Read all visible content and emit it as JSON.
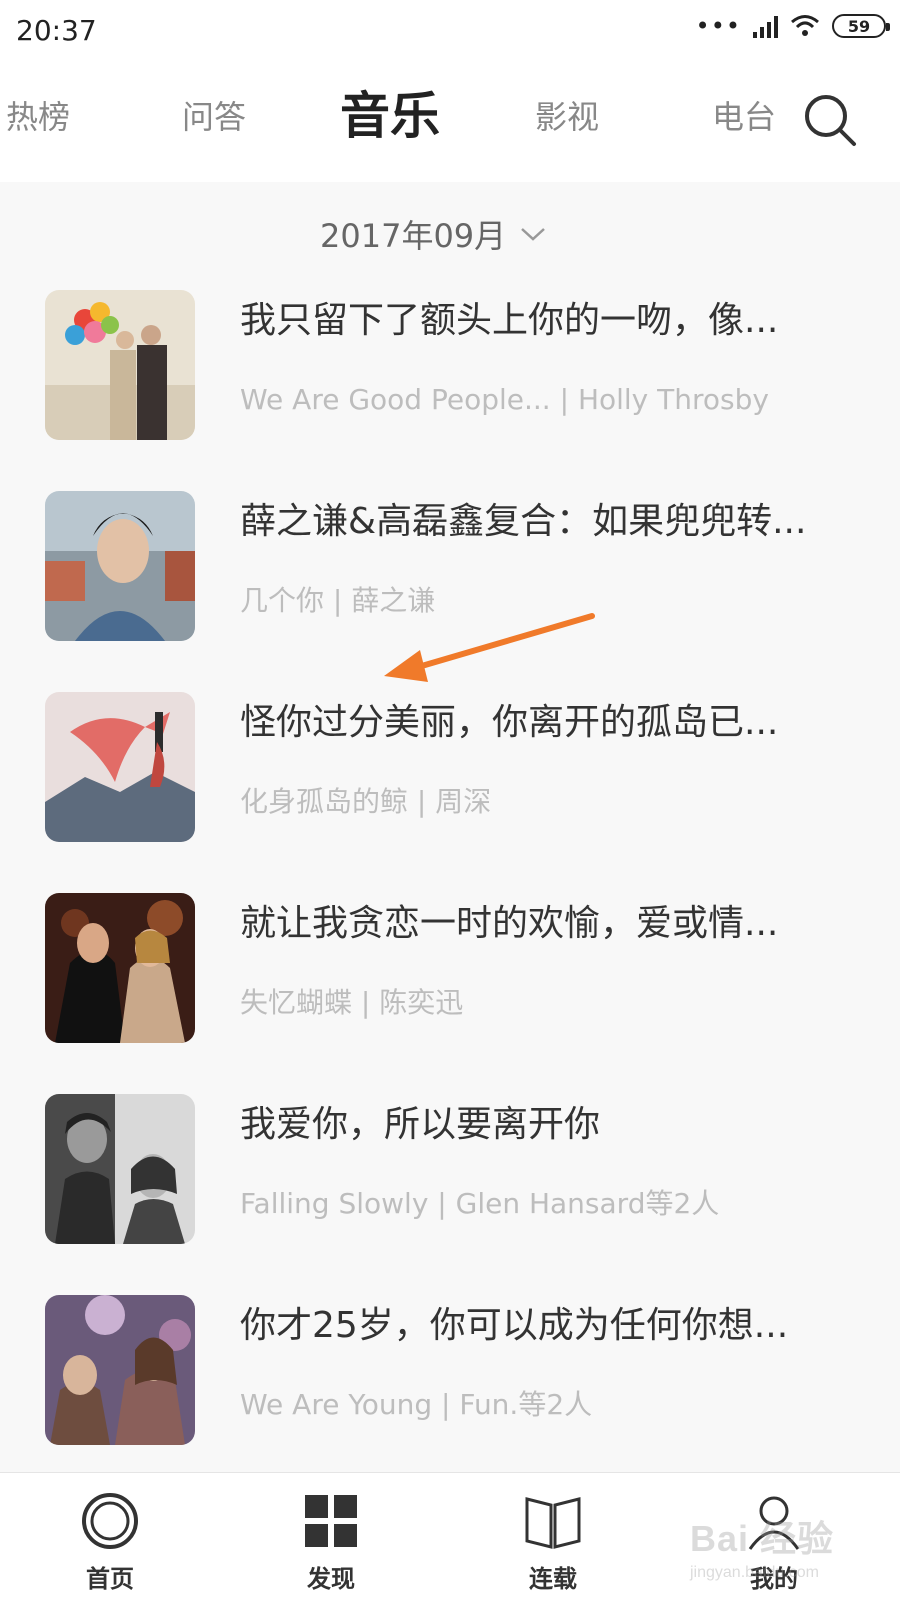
{
  "status_bar": {
    "time": "20:37",
    "battery": "59"
  },
  "top_tabs": [
    {
      "label": "热榜"
    },
    {
      "label": "问答"
    },
    {
      "label": "音乐",
      "active": true
    },
    {
      "label": "影视"
    },
    {
      "label": "电台"
    }
  ],
  "date_selector": {
    "label": "2017年09月"
  },
  "items": [
    {
      "title": "我只留下了额头上你的一吻，像...",
      "subtitle": "We Are Good People... | Holly Throsby"
    },
    {
      "title": "薛之谦&高磊鑫复合：如果兜兜转...",
      "subtitle": "几个你 | 薛之谦"
    },
    {
      "title": "怪你过分美丽，你离开的孤岛已...",
      "subtitle": "化身孤岛的鲸 | 周深"
    },
    {
      "title": "就让我贪恋一时的欢愉，爱或情...",
      "subtitle": "失忆蝴蝶 | 陈奕迅"
    },
    {
      "title": "我爱你，所以要离开你",
      "subtitle": "Falling Slowly | Glen Hansard等2人"
    },
    {
      "title": "你才25岁，你可以成为任何你想...",
      "subtitle": "We Are Young | Fun.等2人"
    }
  ],
  "bottom_nav": [
    {
      "label": "首页"
    },
    {
      "label": "发现"
    },
    {
      "label": "连载"
    },
    {
      "label": "我的"
    }
  ],
  "watermark": {
    "main": "Bai 经验",
    "sub": "jingyan.baidu.com"
  },
  "colors": {
    "accent_arrow": "#f07a2a",
    "title_text": "#333333",
    "subtitle_text": "#bdbdbd",
    "tab_inactive": "#888888"
  }
}
